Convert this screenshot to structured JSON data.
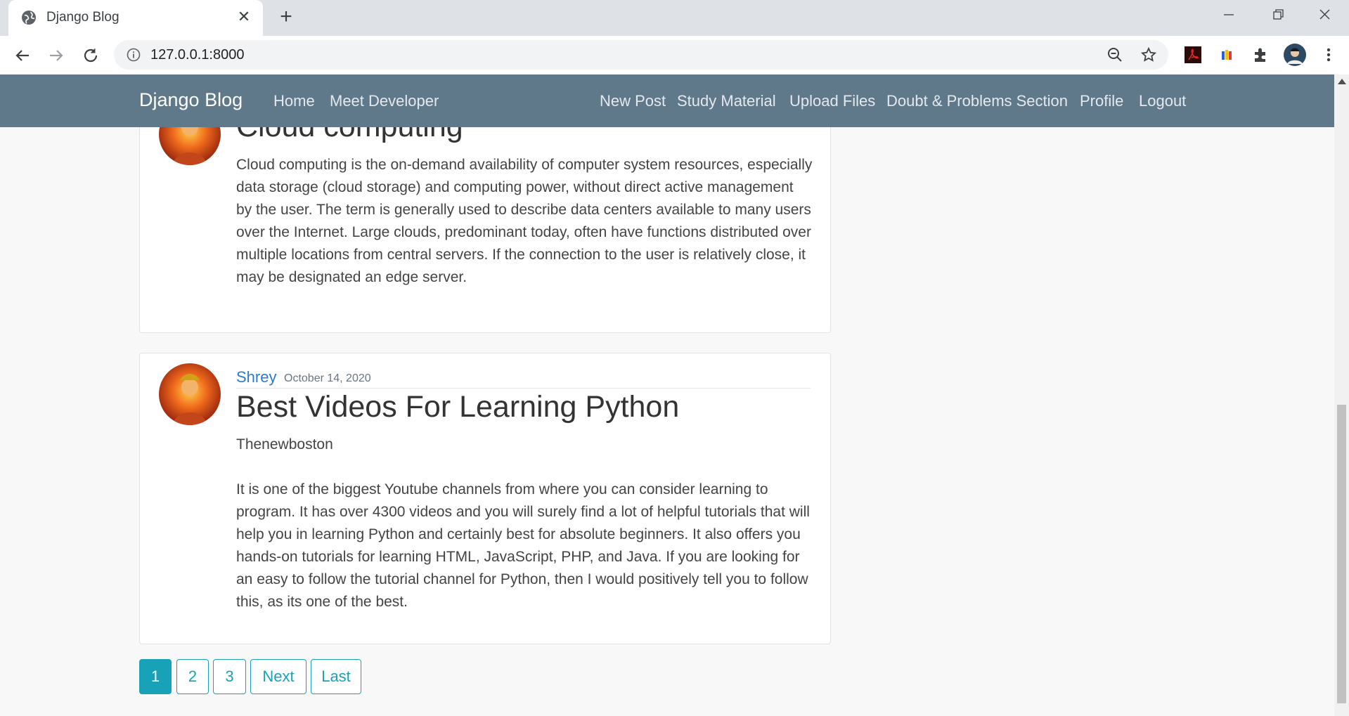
{
  "browser": {
    "tab_title": "Django Blog",
    "url": "127.0.0.1:8000"
  },
  "navbar": {
    "brand": "Django Blog",
    "left_links": [
      "Home",
      "Meet Developer"
    ],
    "right_links": [
      "New Post",
      "Study Material",
      "Upload Files",
      "Doubt & Problems Section",
      "Profile",
      "Logout"
    ]
  },
  "posts": [
    {
      "title": "Cloud computing",
      "body": [
        "Cloud computing is the on-demand availability of computer system resources, especially data storage (cloud storage) and computing power, without direct active management by the user. The term is generally used to describe data centers available to many users over the Internet. Large clouds, predominant today, often have functions distributed over multiple locations from central servers. If the connection to the user is relatively close, it may be designated an edge server."
      ]
    },
    {
      "author": "Shrey",
      "date": "October 14, 2020",
      "title": "Best Videos For Learning Python",
      "body": [
        "Thenewboston",
        "It is one of the biggest Youtube channels from where you can consider learning to program. It has over 4300 videos and you will surely find a lot of helpful tutorials that will help you in learning Python and certainly best for absolute beginners. It also offers you hands-on tutorials for learning HTML, JavaScript, PHP, and Java. If you are looking for an easy to follow the tutorial channel for Python, then I would positively tell you to follow this, as its one of the best."
      ]
    }
  ],
  "pagination": [
    "1",
    "2",
    "3",
    "Next",
    "Last"
  ],
  "colors": {
    "navbar": "#5f788a",
    "link": "#2a7bd1",
    "pager": "#17a2b8"
  },
  "icons": [
    "globe-icon",
    "close-icon",
    "plus-icon",
    "back-icon",
    "forward-icon",
    "reload-icon",
    "info-icon",
    "zoom-out-icon",
    "star-icon",
    "pdf-extension-icon",
    "color-extension-icon",
    "puzzle-icon",
    "profile-avatar",
    "more-vert-icon"
  ]
}
